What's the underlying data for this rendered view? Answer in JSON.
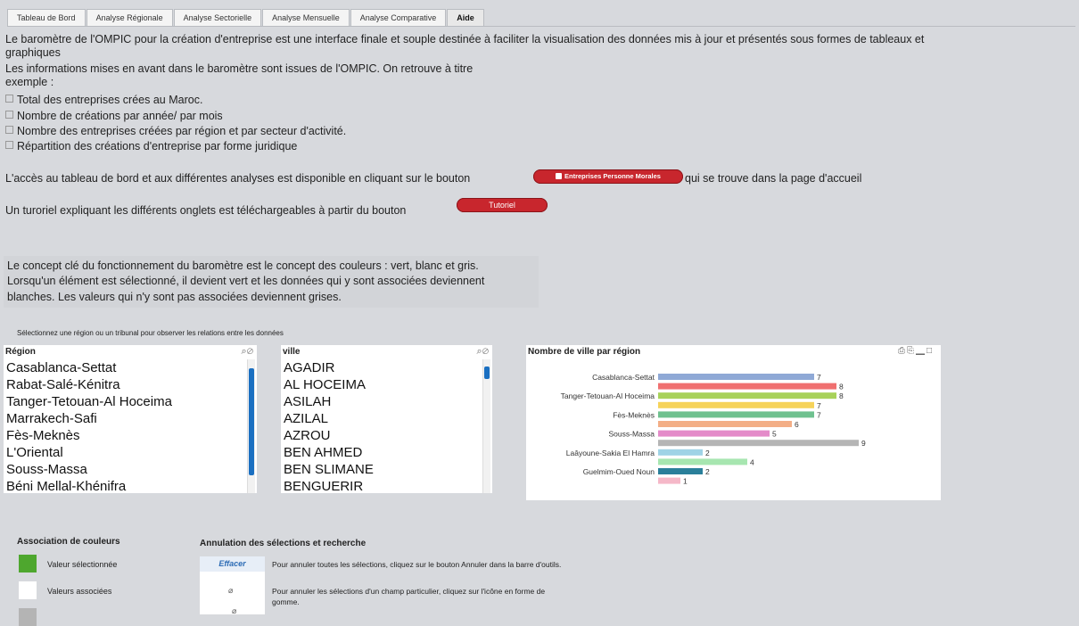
{
  "tabs": [
    "Tableau de Bord",
    "Analyse Régionale",
    "Analyse Sectorielle",
    "Analyse Mensuelle",
    "Analyse Comparative",
    "Aide"
  ],
  "active_tab": "Aide",
  "intro": {
    "line1": "Le baromètre de l'OMPIC pour la création d'entreprise est une interface finale et souple destinée à faciliter la visualisation des données mis à jour et présentés sous formes de tableaux et graphiques",
    "line2": "Les informations mises en avant dans le baromètre sont issues de l'OMPIC. On retrouve à titre exemple :",
    "bullets": [
      "Total des entreprises crées au Maroc.",
      "Nombre de créations par année/ par mois",
      "Nombre des entreprises créées par région et par secteur d'activité.",
      "Répartition des créations d'entreprise par forme juridique"
    ],
    "access_before": "L'accès au tableau de bord et aux différentes analyses est disponible en cliquant sur le bouton",
    "access_button": "Entreprises Personne Morales",
    "access_after": "qui se trouve dans la page d'accueil",
    "tutorial_text": "Un turoriel expliquant les différents onglets est téléchargeables à partir du bouton",
    "tutorial_button": "Tutoriel"
  },
  "concept": {
    "line1": "Le concept clé du fonctionnement du baromètre est le concept des couleurs : vert, blanc et gris.",
    "line2": "Lorsqu'un élément est sélectionné, il devient vert et les données qui y sont associées deviennent",
    "line3": "blanches. Les valeurs qui n'y sont pas associées deviennent grises."
  },
  "select_hint": "Sélectionnez une région ou un tribunal pour observer les relations entre les données",
  "region_list": {
    "title": "Région",
    "items": [
      "Casablanca-Settat",
      "Rabat-Salé-Kénitra",
      "Tanger-Tetouan-Al Hoceima",
      "Marrakech-Safi",
      "Fès-Meknès",
      "L'Oriental",
      "Souss-Massa",
      "Béni Mellal-Khénifra"
    ]
  },
  "ville_list": {
    "title": "ville",
    "items": [
      "AGADIR",
      "AL HOCEIMA",
      "ASILAH",
      "AZILAL",
      "AZROU",
      "BEN AHMED",
      "BEN SLIMANE",
      "BENGUERIR"
    ]
  },
  "chart_data": {
    "type": "bar",
    "orientation": "horizontal",
    "title": "Nombre de ville par région",
    "categories": [
      "Casablanca-Settat",
      "",
      "Tanger-Tetouan-Al Hoceima",
      "",
      "Fès-Meknès",
      "",
      "Souss-Massa",
      "",
      "Laâyoune-Sakia El Hamra",
      "",
      "Guelmim-Oued Noun",
      ""
    ],
    "values": [
      7,
      8,
      8,
      7,
      7,
      6,
      5,
      9,
      2,
      4,
      2,
      1
    ],
    "colors": [
      "#8fa9d6",
      "#f07070",
      "#a8d25a",
      "#f6d35a",
      "#6fc18f",
      "#f3ae86",
      "#e48bc9",
      "#b5b5b5",
      "#9fd3e6",
      "#a7e6b0",
      "#2a7f9a",
      "#f5b8c8"
    ],
    "xlim": [
      0,
      9
    ]
  },
  "legend_colors": {
    "title": "Association de couleurs",
    "items": [
      {
        "label": "Valeur sélectionnée",
        "color": "#4ea72e"
      },
      {
        "label": "Valeurs associées",
        "color": "#ffffff"
      },
      {
        "label": "",
        "color": "#b4b4b4"
      }
    ]
  },
  "annulation": {
    "title": "Annulation des sélections et recherche",
    "button": "Effacer",
    "rows": [
      "Pour annuler toutes les sélections, cliquez sur le bouton Annuler dans la barre d'outils.",
      "Pour annuler les sélections d'un champ particulier, cliquez sur l'icône en forme de gomme."
    ]
  }
}
